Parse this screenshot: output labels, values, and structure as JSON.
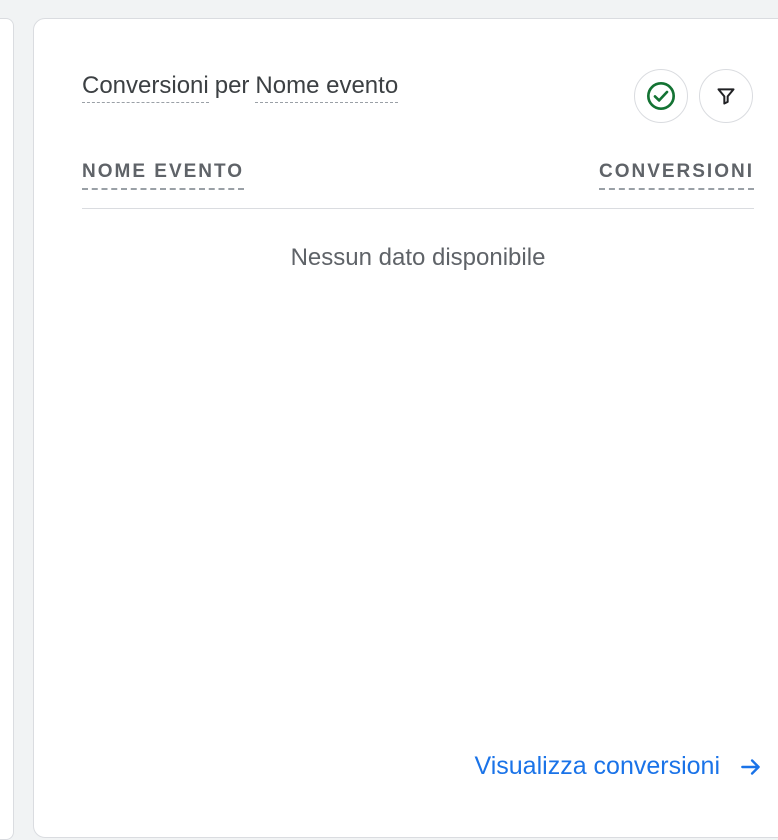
{
  "card": {
    "title": {
      "part1": "Conversioni",
      "part2": "per",
      "part3": "Nome evento"
    },
    "status_icon": "check-circle-icon",
    "filter_icon": "filter-icon"
  },
  "table": {
    "columns": [
      "NOME EVENTO",
      "CONVERSIONI"
    ],
    "rows": [],
    "empty_message": "Nessun dato disponibile"
  },
  "footer": {
    "link_label": "Visualizza conversioni",
    "link_icon": "arrow-right-icon"
  },
  "colors": {
    "accent": "#1a73e8",
    "success": "#137333"
  }
}
